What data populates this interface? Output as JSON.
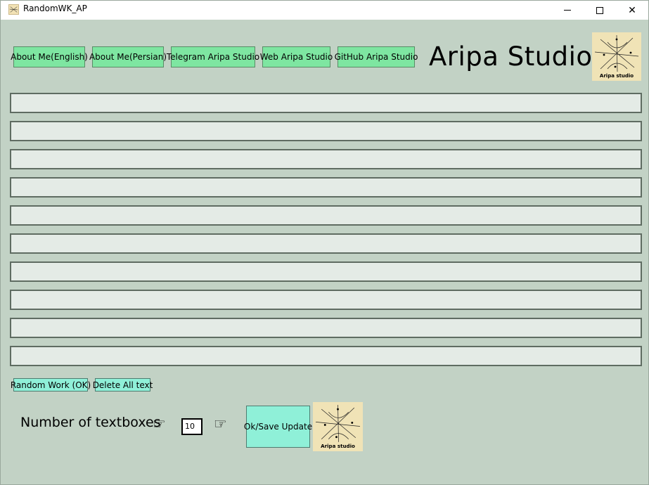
{
  "window": {
    "title": "RandomWK_AP"
  },
  "header": {
    "links": [
      {
        "label": "About Me(English)"
      },
      {
        "label": "About Me(Persian)"
      },
      {
        "label": "Telegram Aripa Studio"
      },
      {
        "label": "Web Aripa Studio"
      },
      {
        "label": "GitHub Aripa Studio"
      }
    ],
    "brand": "Aripa Studio",
    "logo_text": "Aripa studio"
  },
  "textboxes": [
    "",
    "",
    "",
    "",
    "",
    "",
    "",
    "",
    "",
    ""
  ],
  "actions": {
    "random_label": "Random Work (OK)",
    "delete_label": "Delete All text"
  },
  "settings": {
    "count_label": "Number of textboxes",
    "count_value": "10",
    "ok_label": "Ok/Save Update",
    "logo_text": "Aripa studio"
  },
  "colors": {
    "background": "#c2d2c5",
    "link_button": "#7ee6a1",
    "action_button": "#8ff0d8",
    "textbox": "#e4ebe6",
    "logo_bg": "#f0e3b6"
  },
  "icons": {
    "hand": "pointing-hand-icon"
  }
}
